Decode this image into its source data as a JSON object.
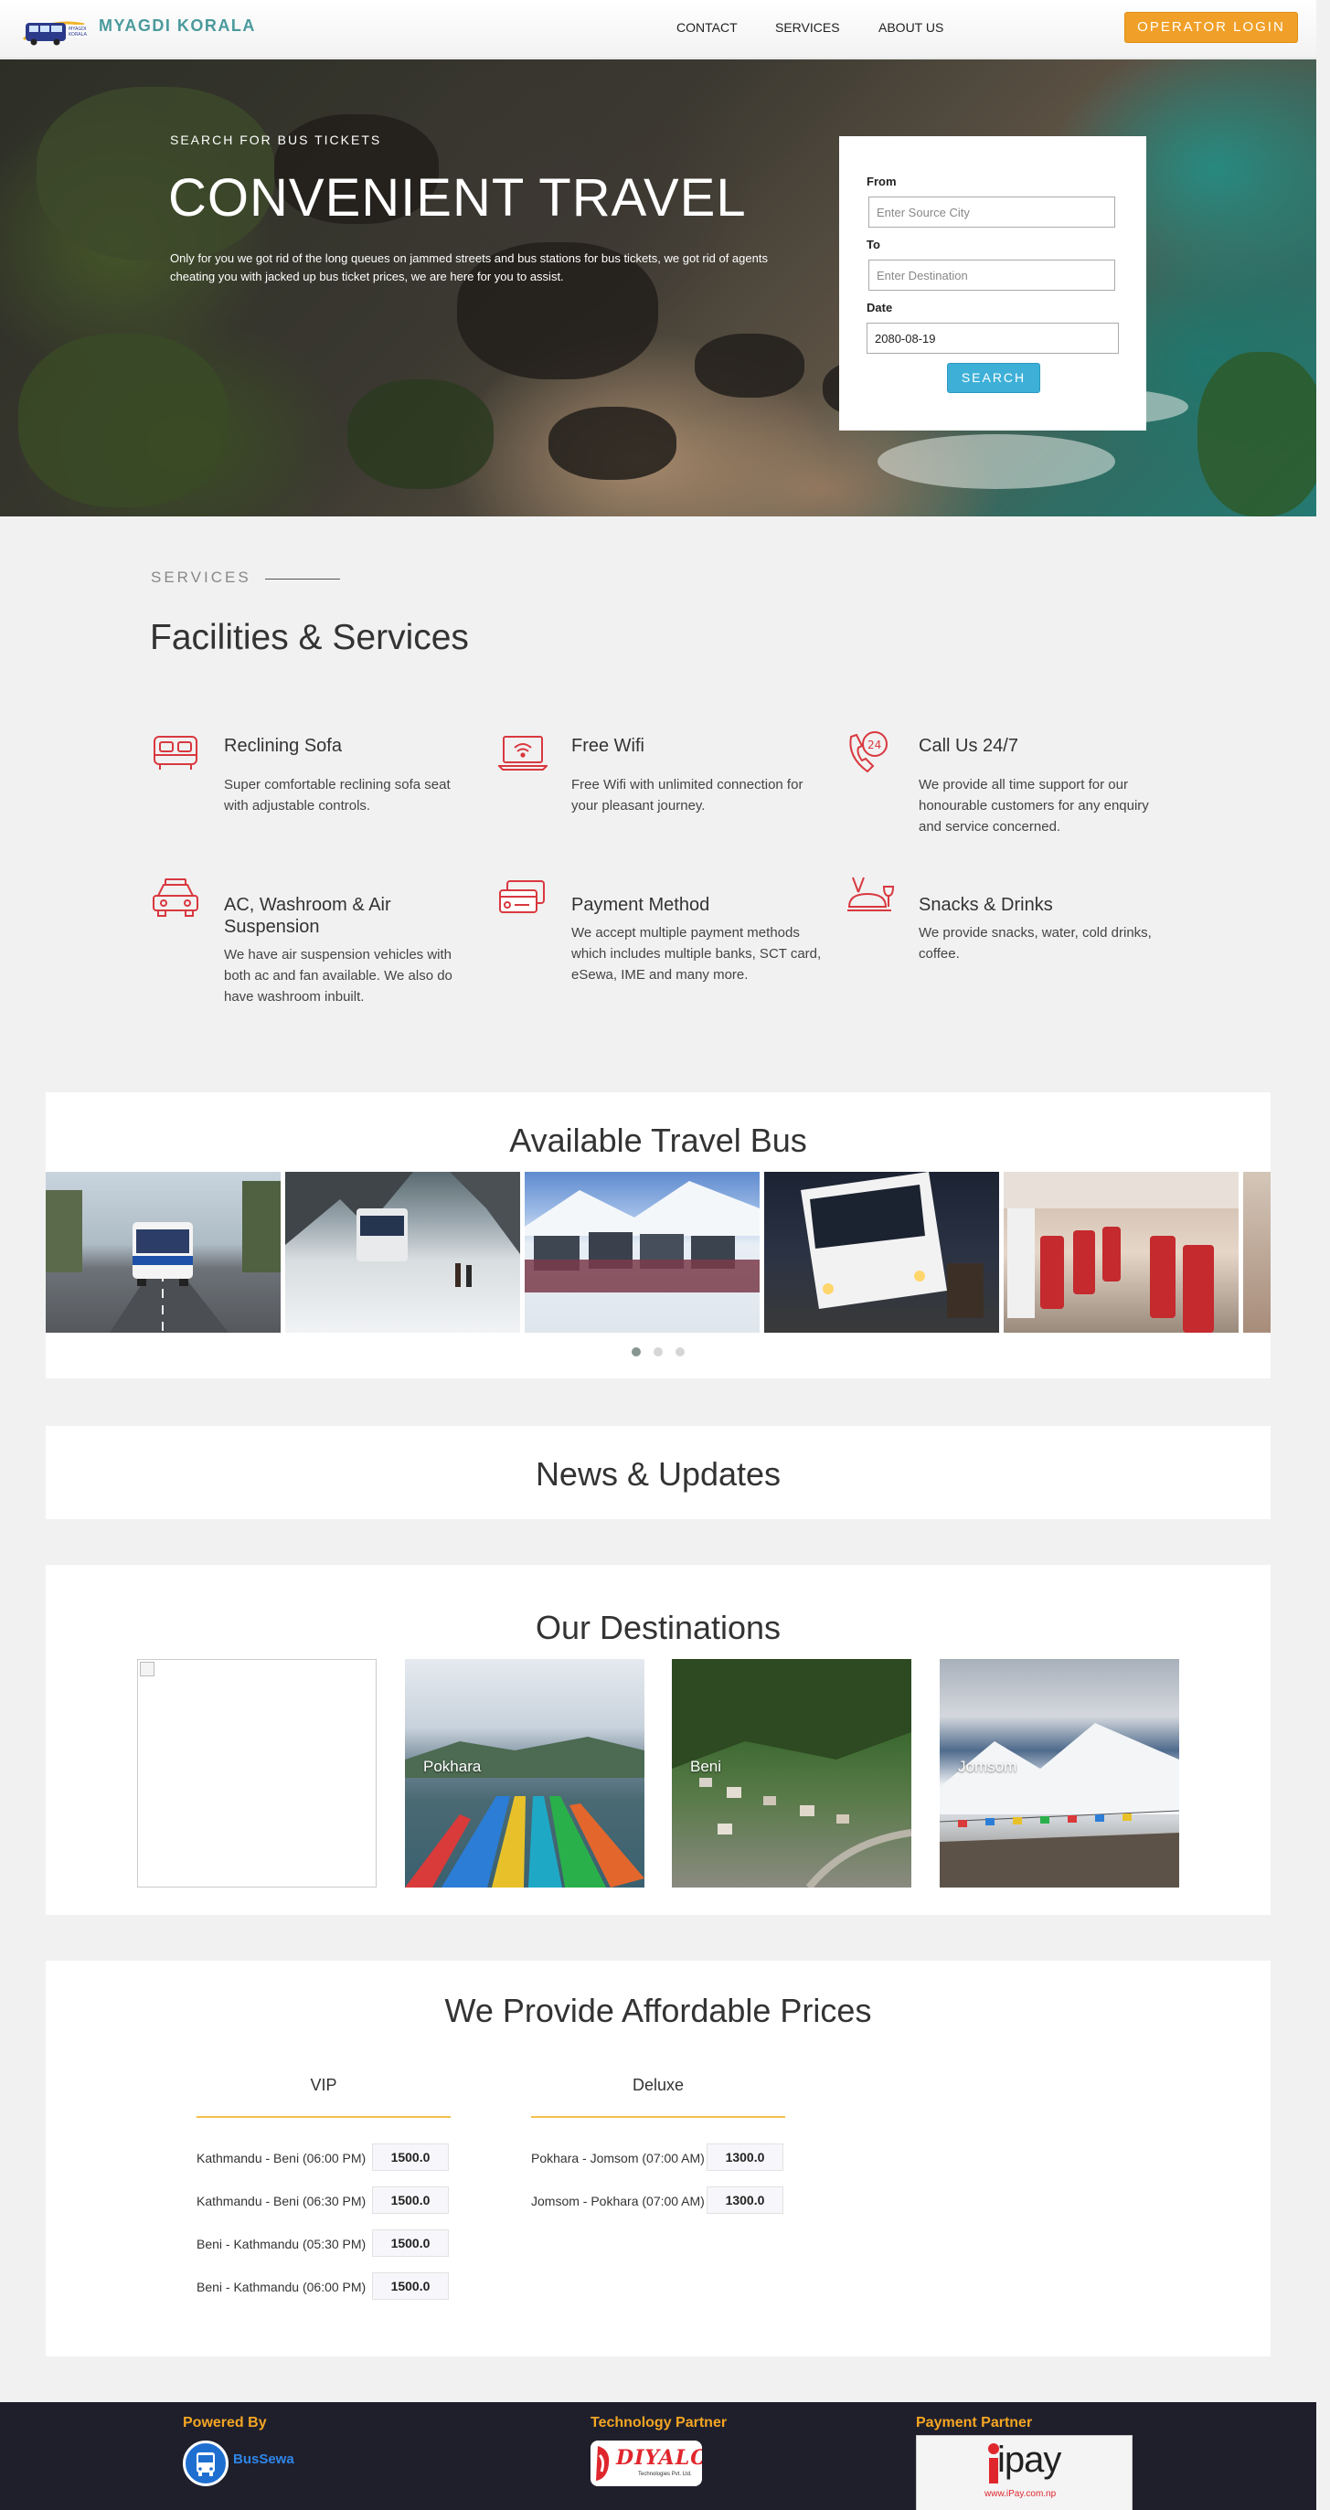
{
  "nav": {
    "brand": "MYAGDI KORALA",
    "links": [
      "CONTACT",
      "SERVICES",
      "ABOUT US"
    ],
    "operator_login": "OPERATOR LOGIN"
  },
  "hero": {
    "eyebrow": "SEARCH FOR BUS TICKETS",
    "title": "CONVENIENT TRAVEL",
    "description": "Only for you we got rid of the long queues on jammed streets and bus stations for bus tickets, we got rid of agents cheating you with jacked up bus ticket prices, we are here for you to assist."
  },
  "search_form": {
    "from_label": "From",
    "from_placeholder": "Enter Source City",
    "to_label": "To",
    "to_placeholder": "Enter Destination",
    "date_label": "Date",
    "date_value": "2080-08-19",
    "submit": "SEARCH"
  },
  "services": {
    "eyebrow": "SERVICES",
    "title": "Facilities & Services",
    "items": [
      {
        "icon": "sofa-icon",
        "name": "Reclining Sofa",
        "text": "Super comfortable reclining sofa seat with adjustable controls."
      },
      {
        "icon": "laptop-wifi-icon",
        "name": "Free Wifi",
        "text": "Free Wifi with unlimited connection for your pleasant journey."
      },
      {
        "icon": "phone-24-icon",
        "name": "Call Us 24/7",
        "text": "We provide all time support for our honourable customers for any enquiry and service concerned."
      },
      {
        "icon": "car-icon",
        "name": "AC, Washroom & Air Suspension",
        "text": "We have air suspension vehicles with both ac and fan available. We also do have washroom inbuilt."
      },
      {
        "icon": "credit-card-icon",
        "name": "Payment Method",
        "text": "We accept multiple payment methods which includes multiple banks, SCT card, eSewa, IME and many more."
      },
      {
        "icon": "food-tray-icon",
        "name": "Snacks & Drinks",
        "text": "We provide snacks, water, cold drinks, coffee."
      }
    ],
    "accent_color": "#d9383f"
  },
  "travel_bus": {
    "title": "Available Travel Bus",
    "carousel_active_index": 0,
    "carousel_dots": 3
  },
  "news": {
    "title": "News & Updates"
  },
  "destinations": {
    "title": "Our Destinations",
    "items": [
      "",
      "Pokhara",
      "Beni",
      "Jomsom"
    ]
  },
  "prices": {
    "title": "We Provide Affordable Prices",
    "vip": {
      "label": "VIP",
      "rows": [
        {
          "route": "Kathmandu - Beni (06:00 PM)",
          "price": "1500.0"
        },
        {
          "route": "Kathmandu - Beni (06:30 PM)",
          "price": "1500.0"
        },
        {
          "route": "Beni - Kathmandu (05:30 PM)",
          "price": "1500.0"
        },
        {
          "route": "Beni - Kathmandu (06:00 PM)",
          "price": "1500.0"
        }
      ]
    },
    "deluxe": {
      "label": "Deluxe",
      "rows": [
        {
          "route": "Pokhara - Jomsom (07:00 AM)",
          "price": "1300.0"
        },
        {
          "route": "Jomsom - Pokhara (07:00 AM)",
          "price": "1300.0"
        }
      ]
    }
  },
  "footer": {
    "powered_by": "Powered By",
    "powered_name": "BusSewa",
    "tech_partner": "Technology Partner",
    "tech_partner_logo_text": "DIYALO",
    "tech_partner_sub": "Technologies Pvt. Ltd.",
    "payment_partner": "Payment Partner",
    "payment_logo_text": "ipay",
    "payment_logo_url": "www.iPay.com.np"
  }
}
